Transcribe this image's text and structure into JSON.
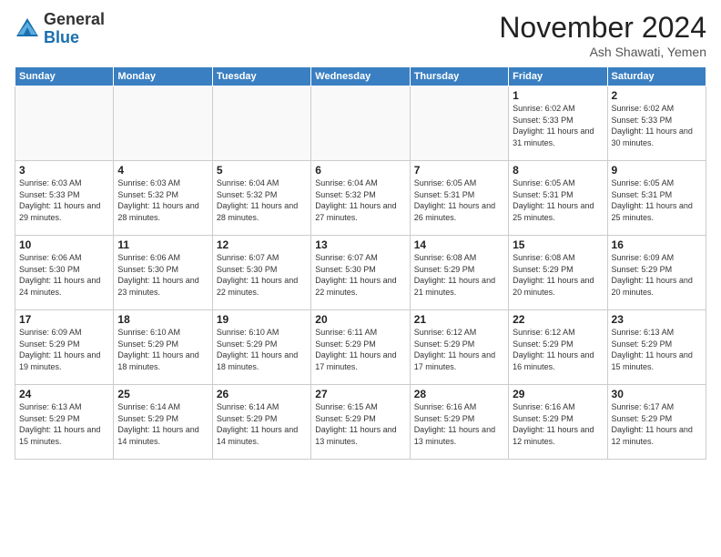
{
  "logo": {
    "general": "General",
    "blue": "Blue"
  },
  "title": "November 2024",
  "subtitle": "Ash Shawati, Yemen",
  "headers": [
    "Sunday",
    "Monday",
    "Tuesday",
    "Wednesday",
    "Thursday",
    "Friday",
    "Saturday"
  ],
  "weeks": [
    [
      {
        "day": "",
        "info": ""
      },
      {
        "day": "",
        "info": ""
      },
      {
        "day": "",
        "info": ""
      },
      {
        "day": "",
        "info": ""
      },
      {
        "day": "",
        "info": ""
      },
      {
        "day": "1",
        "info": "Sunrise: 6:02 AM\nSunset: 5:33 PM\nDaylight: 11 hours and 31 minutes."
      },
      {
        "day": "2",
        "info": "Sunrise: 6:02 AM\nSunset: 5:33 PM\nDaylight: 11 hours and 30 minutes."
      }
    ],
    [
      {
        "day": "3",
        "info": "Sunrise: 6:03 AM\nSunset: 5:33 PM\nDaylight: 11 hours and 29 minutes."
      },
      {
        "day": "4",
        "info": "Sunrise: 6:03 AM\nSunset: 5:32 PM\nDaylight: 11 hours and 28 minutes."
      },
      {
        "day": "5",
        "info": "Sunrise: 6:04 AM\nSunset: 5:32 PM\nDaylight: 11 hours and 28 minutes."
      },
      {
        "day": "6",
        "info": "Sunrise: 6:04 AM\nSunset: 5:32 PM\nDaylight: 11 hours and 27 minutes."
      },
      {
        "day": "7",
        "info": "Sunrise: 6:05 AM\nSunset: 5:31 PM\nDaylight: 11 hours and 26 minutes."
      },
      {
        "day": "8",
        "info": "Sunrise: 6:05 AM\nSunset: 5:31 PM\nDaylight: 11 hours and 25 minutes."
      },
      {
        "day": "9",
        "info": "Sunrise: 6:05 AM\nSunset: 5:31 PM\nDaylight: 11 hours and 25 minutes."
      }
    ],
    [
      {
        "day": "10",
        "info": "Sunrise: 6:06 AM\nSunset: 5:30 PM\nDaylight: 11 hours and 24 minutes."
      },
      {
        "day": "11",
        "info": "Sunrise: 6:06 AM\nSunset: 5:30 PM\nDaylight: 11 hours and 23 minutes."
      },
      {
        "day": "12",
        "info": "Sunrise: 6:07 AM\nSunset: 5:30 PM\nDaylight: 11 hours and 22 minutes."
      },
      {
        "day": "13",
        "info": "Sunrise: 6:07 AM\nSunset: 5:30 PM\nDaylight: 11 hours and 22 minutes."
      },
      {
        "day": "14",
        "info": "Sunrise: 6:08 AM\nSunset: 5:29 PM\nDaylight: 11 hours and 21 minutes."
      },
      {
        "day": "15",
        "info": "Sunrise: 6:08 AM\nSunset: 5:29 PM\nDaylight: 11 hours and 20 minutes."
      },
      {
        "day": "16",
        "info": "Sunrise: 6:09 AM\nSunset: 5:29 PM\nDaylight: 11 hours and 20 minutes."
      }
    ],
    [
      {
        "day": "17",
        "info": "Sunrise: 6:09 AM\nSunset: 5:29 PM\nDaylight: 11 hours and 19 minutes."
      },
      {
        "day": "18",
        "info": "Sunrise: 6:10 AM\nSunset: 5:29 PM\nDaylight: 11 hours and 18 minutes."
      },
      {
        "day": "19",
        "info": "Sunrise: 6:10 AM\nSunset: 5:29 PM\nDaylight: 11 hours and 18 minutes."
      },
      {
        "day": "20",
        "info": "Sunrise: 6:11 AM\nSunset: 5:29 PM\nDaylight: 11 hours and 17 minutes."
      },
      {
        "day": "21",
        "info": "Sunrise: 6:12 AM\nSunset: 5:29 PM\nDaylight: 11 hours and 17 minutes."
      },
      {
        "day": "22",
        "info": "Sunrise: 6:12 AM\nSunset: 5:29 PM\nDaylight: 11 hours and 16 minutes."
      },
      {
        "day": "23",
        "info": "Sunrise: 6:13 AM\nSunset: 5:29 PM\nDaylight: 11 hours and 15 minutes."
      }
    ],
    [
      {
        "day": "24",
        "info": "Sunrise: 6:13 AM\nSunset: 5:29 PM\nDaylight: 11 hours and 15 minutes."
      },
      {
        "day": "25",
        "info": "Sunrise: 6:14 AM\nSunset: 5:29 PM\nDaylight: 11 hours and 14 minutes."
      },
      {
        "day": "26",
        "info": "Sunrise: 6:14 AM\nSunset: 5:29 PM\nDaylight: 11 hours and 14 minutes."
      },
      {
        "day": "27",
        "info": "Sunrise: 6:15 AM\nSunset: 5:29 PM\nDaylight: 11 hours and 13 minutes."
      },
      {
        "day": "28",
        "info": "Sunrise: 6:16 AM\nSunset: 5:29 PM\nDaylight: 11 hours and 13 minutes."
      },
      {
        "day": "29",
        "info": "Sunrise: 6:16 AM\nSunset: 5:29 PM\nDaylight: 11 hours and 12 minutes."
      },
      {
        "day": "30",
        "info": "Sunrise: 6:17 AM\nSunset: 5:29 PM\nDaylight: 11 hours and 12 minutes."
      }
    ]
  ]
}
